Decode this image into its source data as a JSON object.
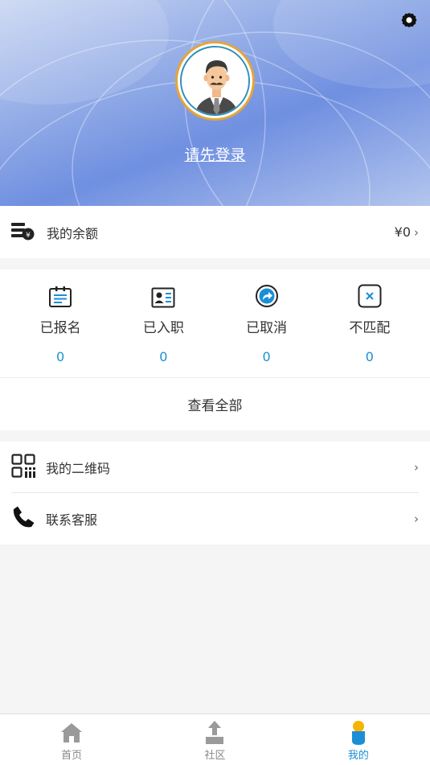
{
  "header": {
    "login_text": "请先登录"
  },
  "balance": {
    "label": "我的余额",
    "value": "¥0"
  },
  "status": {
    "items": [
      {
        "label": "已报名",
        "count": "0",
        "icon": "clipboard-icon"
      },
      {
        "label": "已入职",
        "count": "0",
        "icon": "id-card-icon"
      },
      {
        "label": "已取消",
        "count": "0",
        "icon": "share-arrow-icon"
      },
      {
        "label": "不匹配",
        "count": "0",
        "icon": "x-box-icon"
      }
    ],
    "view_all": "查看全部"
  },
  "menu": {
    "items": [
      {
        "label": "我的二维码",
        "icon": "qr-code-icon"
      },
      {
        "label": "联系客服",
        "icon": "phone-icon"
      }
    ]
  },
  "tabbar": {
    "items": [
      {
        "label": "首页",
        "icon": "home-icon"
      },
      {
        "label": "社区",
        "icon": "community-icon"
      },
      {
        "label": "我的",
        "icon": "profile-icon",
        "active": true
      }
    ]
  },
  "colors": {
    "accent": "#1a8fd6",
    "header_blue": "#6f8fe0",
    "avatar_ring": "#e3a53a"
  }
}
